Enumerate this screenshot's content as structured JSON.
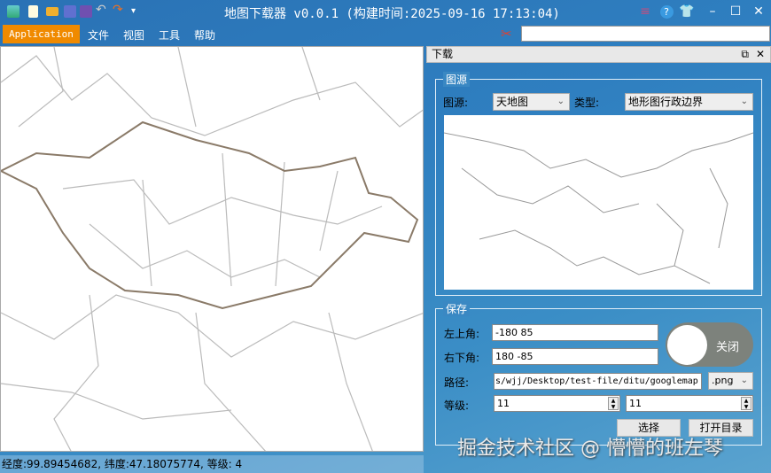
{
  "window": {
    "title": "地图下载器 v0.0.1 (构建时间:2025-09-16 17:13:04)"
  },
  "menu": {
    "application": "Application",
    "items": [
      "文件",
      "视图",
      "工具",
      "帮助"
    ]
  },
  "search": {
    "value": ""
  },
  "panel": {
    "title": "下载",
    "source_group": {
      "title": "图源",
      "source_label": "图源:",
      "source_value": "天地图",
      "type_label": "类型:",
      "type_value": "地形图行政边界"
    },
    "save_group": {
      "title": "保存",
      "top_left_label": "左上角:",
      "top_left_value": "-180 85",
      "bottom_right_label": "右下角:",
      "bottom_right_value": "180 -85",
      "path_label": "路径:",
      "path_value": "s/wjj/Desktop/test-file/ditu/googlemap",
      "format_value": ".png",
      "level_label": "等级:",
      "level_min": "11",
      "level_max": "11",
      "toggle_label": "关闭",
      "toggle_on": false,
      "select_button": "选择",
      "open_dir_button": "打开目录"
    }
  },
  "status": {
    "text": "经度:99.89454682, 纬度:47.18075774, 等级: 4"
  },
  "watermark": "掘金技术社区 @ 懵懵的班左琴"
}
